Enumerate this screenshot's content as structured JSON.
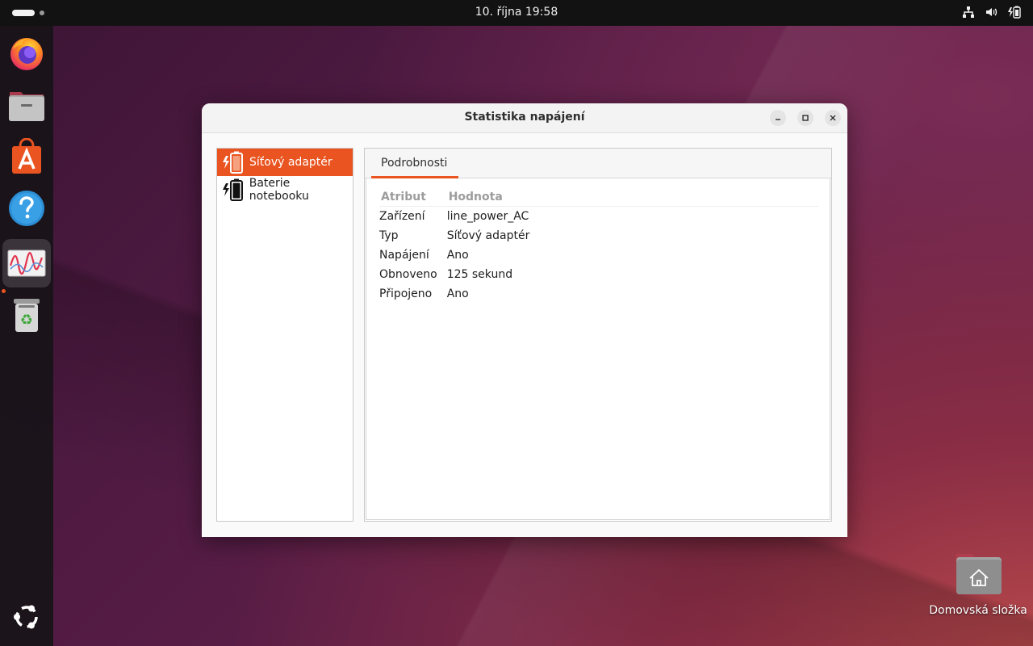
{
  "topbar": {
    "clock": "10. října  19:58"
  },
  "dock": {
    "apps": [
      {
        "name": "Firefox",
        "icon": "firefox-icon"
      },
      {
        "name": "Soubory",
        "icon": "files-icon"
      },
      {
        "name": "App Center",
        "icon": "app-center-icon"
      },
      {
        "name": "Nápověda",
        "icon": "help-icon"
      },
      {
        "name": "Statistika napájení",
        "icon": "power-statistics-icon"
      },
      {
        "name": "Koš",
        "icon": "trash-icon"
      }
    ],
    "show_apps_icon": "ubuntu-logo-icon"
  },
  "desktop": {
    "home_folder_label": "Domovská složka"
  },
  "window": {
    "title": "Statistika napájení",
    "devices": [
      {
        "label": "Síťový adaptér",
        "icon": "ac-adapter-icon",
        "selected": true
      },
      {
        "label": "Baterie notebooku",
        "icon": "battery-charging-icon",
        "selected": false
      }
    ],
    "tab": "Podrobnosti",
    "table": {
      "headers": [
        "Atribut",
        "Hodnota"
      ],
      "rows": [
        [
          "Zařízení",
          "line_power_AC"
        ],
        [
          "Typ",
          "Síťový adaptér"
        ],
        [
          "Napájení",
          "Ano"
        ],
        [
          "Obnoveno",
          "125 sekund"
        ],
        [
          "Připojeno",
          "Ano"
        ]
      ]
    }
  },
  "colors": {
    "accent": "#e95420",
    "topbar": "#121212"
  }
}
